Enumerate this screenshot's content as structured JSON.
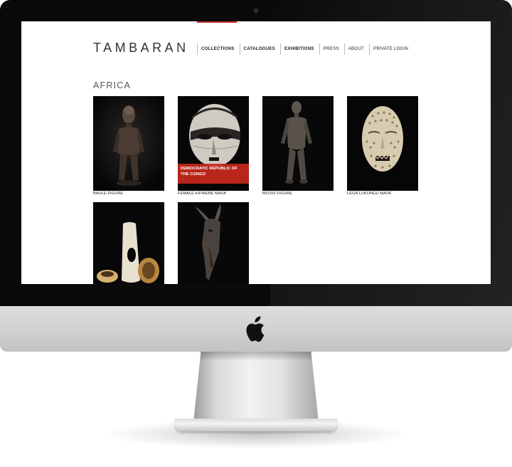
{
  "site": {
    "logo": "TAMBARAN",
    "nav": [
      {
        "label": "COLLECTIONS",
        "active": true
      },
      {
        "label": "CATALOGUES"
      },
      {
        "label": "EXHIBITIONS"
      },
      {
        "label": "PRESS"
      },
      {
        "label": "ABOUT"
      },
      {
        "label": "PRIVATE LOGIN"
      }
    ],
    "accent_color": "#c8342a"
  },
  "section": {
    "title": "AFRICA"
  },
  "items": [
    {
      "caption": "BAULE FIGURE",
      "overlay": ""
    },
    {
      "caption": "FEMALE KIFWEBE MASK",
      "overlay": "DEMOCRATIC REPUBLIC OF THE CONGO"
    },
    {
      "caption": "MOSSI FIGURE",
      "overlay": ""
    },
    {
      "caption": "LEGA LUKUNGU MASK",
      "overlay": ""
    },
    {
      "caption": "",
      "overlay": ""
    },
    {
      "caption": "",
      "overlay": ""
    }
  ],
  "device": {
    "icons": [
      "apple-logo-icon",
      "camera-icon"
    ]
  }
}
